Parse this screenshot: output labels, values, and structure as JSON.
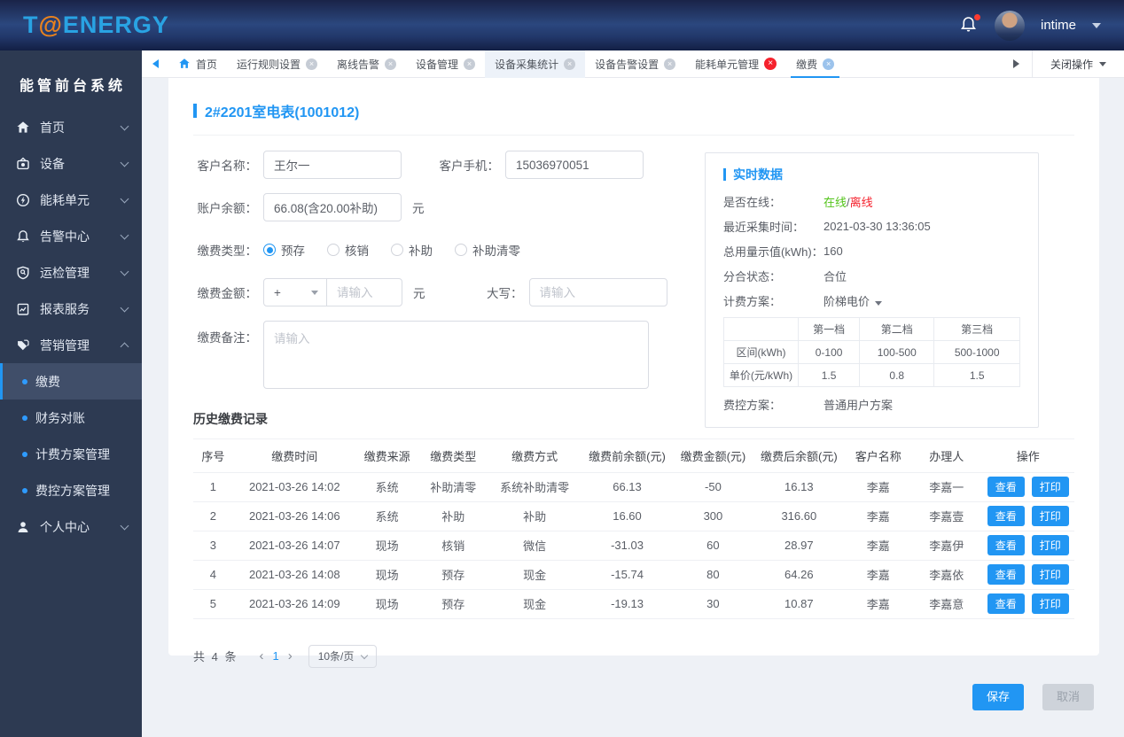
{
  "colors": {
    "accent": "#2196f3",
    "online_green": "#52c41a",
    "offline_red": "#f5222d",
    "logo_blue": "#29a3e3",
    "logo_orange": "#e8821e"
  },
  "topbar": {
    "logo_t": "T",
    "logo_at": "@",
    "logo_rest": "ENERGY",
    "username": "intime"
  },
  "sidebar": {
    "title": "能管前台系统",
    "items": [
      {
        "label": "首页"
      },
      {
        "label": "设备"
      },
      {
        "label": "能耗单元"
      },
      {
        "label": "告警中心"
      },
      {
        "label": "运检管理"
      },
      {
        "label": "报表服务"
      },
      {
        "label": "营销管理"
      },
      {
        "label": "个人中心"
      }
    ],
    "submenu": [
      "缴费",
      "财务对账",
      "计费方案管理",
      "费控方案管理"
    ]
  },
  "tabs": {
    "items": [
      {
        "label": "首页"
      },
      {
        "label": "运行规则设置"
      },
      {
        "label": "离线告警"
      },
      {
        "label": "设备管理"
      },
      {
        "label": "设备采集统计"
      },
      {
        "label": "设备告警设置"
      },
      {
        "label": "能耗单元管理"
      },
      {
        "label": "缴费"
      }
    ],
    "close_glyph": "×",
    "close_action": "关闭操作"
  },
  "page": {
    "title": "2#2201室电表(1001012)",
    "form": {
      "customer_name_label": "客户名称：",
      "customer_name": "王尔一",
      "customer_phone_label": "客户手机：",
      "customer_phone": "15036970051",
      "balance_label": "账户余额：",
      "balance": "66.08(含20.00补助)",
      "unit_yuan": "元",
      "pay_type_label": "缴费类型：",
      "pay_types": [
        "预存",
        "核销",
        "补助",
        "补助清零"
      ],
      "pay_type_selected": "预存",
      "amount_label": "缴费金额：",
      "amount_sign": "+",
      "amount_placeholder": "请输入",
      "caps_label": "大写：",
      "caps_placeholder": "请输入",
      "remark_label": "缴费备注：",
      "remark_placeholder": "请输入"
    },
    "realtime": {
      "title": "实时数据",
      "online_label": "是否在线：",
      "online_on": "在线",
      "online_sep": "/",
      "online_off": "离线",
      "rows": [
        {
          "label": "最近采集时间：",
          "value": "2021-03-30 13:36:05"
        },
        {
          "label": "总用量示值(kWh)：",
          "value": "160"
        },
        {
          "label": "分合状态：",
          "value": "合位"
        }
      ],
      "plan_label": "计费方案：",
      "plan_value": "阶梯电价",
      "tier_table": {
        "header": [
          "",
          "第一档",
          "第二档",
          "第三档"
        ],
        "rows": [
          {
            "label": "区间(kWh)",
            "values": [
              "0-100",
              "100-500",
              "500-1000"
            ]
          },
          {
            "label": "单价(元/kWh)",
            "values": [
              "1.5",
              "0.8",
              "1.5"
            ]
          }
        ]
      },
      "fee_plan_label": "费控方案：",
      "fee_plan_value": "普通用户方案"
    },
    "history": {
      "title": "历史缴费记录",
      "columns": [
        "序号",
        "缴费时间",
        "缴费来源",
        "缴费类型",
        "缴费方式",
        "缴费前余额(元)",
        "缴费金额(元)",
        "缴费后余额(元)",
        "客户名称",
        "办理人",
        "操作"
      ],
      "rows": [
        [
          "1",
          "2021-03-26 14:02",
          "系统",
          "补助清零",
          "系统补助清零",
          "66.13",
          "-50",
          "16.13",
          "李嘉",
          "李嘉一"
        ],
        [
          "2",
          "2021-03-26 14:06",
          "系统",
          "补助",
          "补助",
          "16.60",
          "300",
          "316.60",
          "李嘉",
          "李嘉壹"
        ],
        [
          "3",
          "2021-03-26 14:07",
          "现场",
          "核销",
          "微信",
          "-31.03",
          "60",
          "28.97",
          "李嘉",
          "李嘉伊"
        ],
        [
          "4",
          "2021-03-26 14:08",
          "现场",
          "预存",
          "现金",
          "-15.74",
          "80",
          "64.26",
          "李嘉",
          "李嘉依"
        ],
        [
          "5",
          "2021-03-26 14:09",
          "现场",
          "预存",
          "现金",
          "-19.13",
          "30",
          "10.87",
          "李嘉",
          "李嘉意"
        ]
      ],
      "view_label": "查看",
      "print_label": "打印"
    },
    "pagination": {
      "total": "共 4 条",
      "prev": "‹",
      "page": "1",
      "next": "›",
      "page_size": "10条/页"
    },
    "save_label": "保存",
    "cancel_label": "取消"
  }
}
